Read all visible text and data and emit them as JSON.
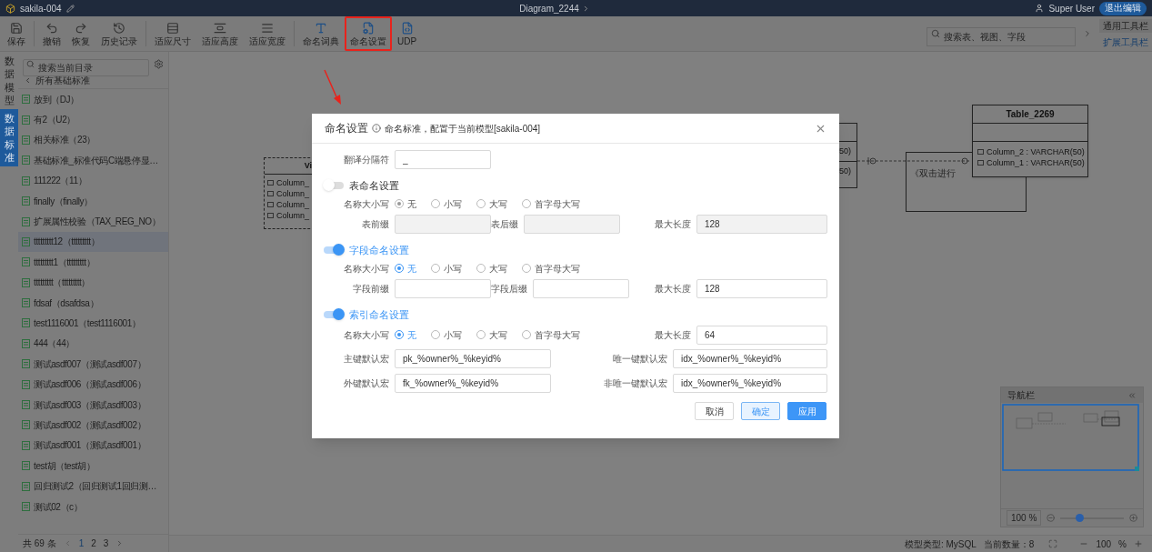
{
  "top_bar": {
    "project": "sakila-004",
    "diagram": "Diagram_2244",
    "user": "Super User",
    "exit_button": "退出编辑"
  },
  "toolbar": {
    "items": [
      {
        "label": "保存",
        "highlighted": false
      },
      {
        "label": "撤销",
        "highlighted": false
      },
      {
        "label": "恢复",
        "highlighted": false
      },
      {
        "label": "历史记录",
        "highlighted": false
      },
      {
        "label": "适应尺寸",
        "highlighted": false
      },
      {
        "label": "适应高度",
        "highlighted": false
      },
      {
        "label": "适应宽度",
        "highlighted": false
      },
      {
        "label": "命名词典",
        "highlighted": false
      },
      {
        "label": "命名设置",
        "highlighted": true
      },
      {
        "label": "UDP",
        "highlighted": false
      }
    ],
    "search": {
      "placeholder": "搜索表、视图、字段"
    },
    "tabs": [
      {
        "label": "通用工具栏",
        "selected": true
      },
      {
        "label": "扩展工具栏",
        "selected": false
      }
    ]
  },
  "side_tabs": [
    {
      "label": "数据模型",
      "selected": false
    },
    {
      "label": "数据标准",
      "selected": true
    }
  ],
  "sidebar": {
    "search": {
      "placeholder": "搜索当前目录"
    },
    "breadcrumb": "所有基础标准",
    "items": [
      {
        "label": "放到（DJ）",
        "selected": false
      },
      {
        "label": "有2（U2）",
        "selected": false
      },
      {
        "label": "相关标准（23）",
        "selected": false
      },
      {
        "label": "基础标准_标准代码C端悬停显…",
        "selected": false
      },
      {
        "label": "111222（11）",
        "selected": false
      },
      {
        "label": "finally（finally）",
        "selected": false
      },
      {
        "label": "扩展属性校验（TAX_REG_NO）",
        "selected": false
      },
      {
        "label": "ttttttttt12（ttttttttt）",
        "selected": true
      },
      {
        "label": "ttttttttt1（ttttttttt）",
        "selected": false
      },
      {
        "label": "ttttttttt（ttttttttt）",
        "selected": false
      },
      {
        "label": "fdsaf（dsafdsa）",
        "selected": false
      },
      {
        "label": "test1116001（test1116001）",
        "selected": false
      },
      {
        "label": "444（44）",
        "selected": false
      },
      {
        "label": "测试asdf007（测试asdf007）",
        "selected": false
      },
      {
        "label": "测试asdf006（测试asdf006）",
        "selected": false
      },
      {
        "label": "测试asdf003（测试asdf003）",
        "selected": false
      },
      {
        "label": "测试asdf002（测试asdf002）",
        "selected": false
      },
      {
        "label": "测试asdf001（测试asdf001）",
        "selected": false
      },
      {
        "label": "test胡（test胡）",
        "selected": false
      },
      {
        "label": "回归测试2（回归测试1回归测…",
        "selected": false
      },
      {
        "label": "测试02（c）",
        "selected": false
      }
    ],
    "pagination": {
      "total": "共 69 条",
      "pages": [
        {
          "label": "1",
          "selected": true
        },
        {
          "label": "2",
          "selected": false
        },
        {
          "label": "3",
          "selected": false
        }
      ]
    }
  },
  "canvas": {
    "tables": [
      {
        "title": "Vi",
        "columns": [
          "Column_",
          "Column_",
          "Column_",
          "Column_"
        ]
      },
      {
        "columns": [
          "50)",
          "50)"
        ]
      },
      {
        "title": "Table_2269",
        "columns": [
          "Column_2 : VARCHAR(50)",
          "Column_1 : VARCHAR(50)"
        ]
      }
    ],
    "note": "《双击进行",
    "navigator": {
      "title": "导航栏",
      "zoom": "100 %",
      "level": 0.3
    }
  },
  "status_bar": {
    "model_type": "模型类型: MySQL",
    "count": "当前数量：8",
    "zoom": "100",
    "unit": "%"
  },
  "dialog": {
    "title": "命名设置",
    "subtitle": "命名标准，配置于当前模型[sakila-004]",
    "separator": {
      "label": "翻译分隔符",
      "value": "_"
    },
    "sections": [
      {
        "kind": "standard",
        "title": "表命名设置",
        "on": false,
        "case_label": "名称大小写",
        "case_options": [
          {
            "label": "无",
            "selected": true
          },
          {
            "label": "小写",
            "selected": false
          },
          {
            "label": "大写",
            "selected": false
          },
          {
            "label": "首字母大写",
            "selected": false
          }
        ],
        "fields": [
          {
            "label": "表前缀"
          },
          {
            "label": "表后缀"
          },
          {
            "label": "最大长度",
            "value": "128"
          }
        ]
      },
      {
        "kind": "standard",
        "title": "字段命名设置",
        "on": true,
        "case_label": "名称大小写",
        "case_options": [
          {
            "label": "无",
            "selected": true
          },
          {
            "label": "小写",
            "selected": false
          },
          {
            "label": "大写",
            "selected": false
          },
          {
            "label": "首字母大写",
            "selected": false
          }
        ],
        "fields": [
          {
            "label": "字段前缀"
          },
          {
            "label": "字段后缀"
          },
          {
            "label": "最大长度",
            "value": "128"
          }
        ]
      },
      {
        "kind": "index",
        "title": "索引命名设置",
        "on": true,
        "case_label": "名称大小写",
        "case_options": [
          {
            "label": "无",
            "selected": true
          },
          {
            "label": "小写",
            "selected": false
          },
          {
            "label": "大写",
            "selected": false
          },
          {
            "label": "首字母大写",
            "selected": false
          }
        ],
        "fields": [
          {
            "label": "最大长度",
            "value": "64"
          },
          {
            "label": "主键默认宏",
            "value": "pk_%owner%_%keyid%"
          },
          {
            "label": "唯一键默认宏",
            "value": "idx_%owner%_%keyid%"
          },
          {
            "label": "外键默认宏",
            "value": "fk_%owner%_%keyid%"
          },
          {
            "label": "非唯一键默认宏",
            "value": "idx_%owner%_%keyid%"
          }
        ]
      }
    ],
    "buttons": [
      {
        "label": "取消",
        "kind": "plain"
      },
      {
        "label": "确定",
        "kind": "light"
      },
      {
        "label": "应用",
        "kind": "primary"
      }
    ]
  }
}
